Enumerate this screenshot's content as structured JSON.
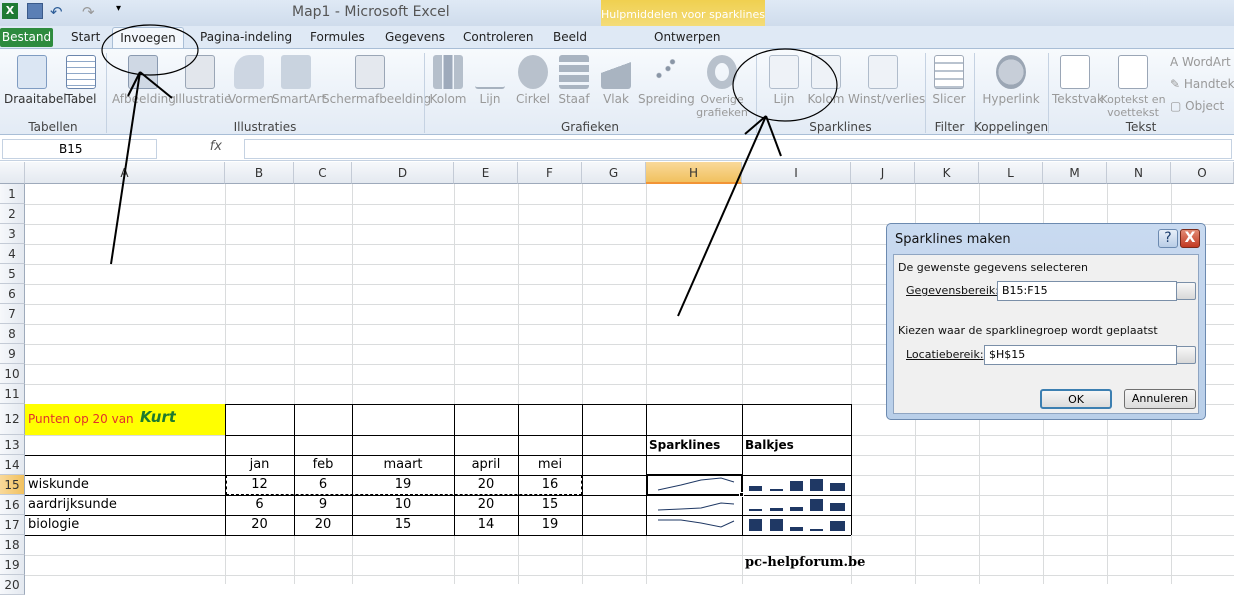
{
  "window": {
    "title": "Map1  -  Microsoft Excel",
    "context_group": "Hulpmiddelen voor sparklines"
  },
  "tabs": [
    "Bestand",
    "Start",
    "Invoegen",
    "Pagina-indeling",
    "Formules",
    "Gegevens",
    "Controleren",
    "Beeld",
    "Ontwerpen"
  ],
  "ribbon": {
    "buttons": [
      "Draaitabel",
      "Tabel",
      "Afbeelding",
      "Illustratie",
      "Vormen",
      "SmartArt",
      "Schermafbeelding",
      "Kolom",
      "Lijn",
      "Cirkel",
      "Staaf",
      "Vlak",
      "Spreiding",
      "Overige grafieken",
      "Lijn",
      "Kolom",
      "Winst/verlies",
      "Slicer",
      "Hyperlink",
      "Tekstvak",
      "Koptekst en voettekst",
      "WordArt",
      "Handtekening",
      "Object"
    ],
    "groups": [
      "Tabellen",
      "Illustraties",
      "Grafieken",
      "Sparklines",
      "Filter",
      "Koppelingen",
      "Tekst"
    ]
  },
  "formula_bar": {
    "name_box": "B15",
    "fx": "fx",
    "formula": ""
  },
  "columns": [
    "A",
    "B",
    "C",
    "D",
    "E",
    "F",
    "G",
    "H",
    "I",
    "J",
    "K",
    "L",
    "M",
    "N",
    "O"
  ],
  "rows": [
    "1",
    "2",
    "3",
    "4",
    "5",
    "6",
    "7",
    "8",
    "9",
    "10",
    "11",
    "12",
    "13",
    "14",
    "15",
    "16",
    "17",
    "18",
    "19",
    "20"
  ],
  "sheet": {
    "title_text": "Punten op 20 van",
    "title_name": "Kurt",
    "h_sparklines": "Sparklines",
    "h_balkjes": "Balkjes",
    "months": [
      "jan",
      "feb",
      "maart",
      "april",
      "mei"
    ],
    "subjects": [
      {
        "name": "wiskunde",
        "scores": [
          "12",
          "6",
          "19",
          "20",
          "16"
        ]
      },
      {
        "name": "aardrijksunde",
        "scores": [
          "6",
          "9",
          "10",
          "20",
          "15"
        ]
      },
      {
        "name": "biologie",
        "scores": [
          "20",
          "20",
          "15",
          "14",
          "19"
        ]
      }
    ],
    "watermark": "pc-helpforum.be"
  },
  "dialog": {
    "title": "Sparklines maken",
    "help": "?",
    "close": "X",
    "section1": "De gewenste gegevens selecteren",
    "data_label": "Gegevensbereik:",
    "data_value": "B15:F15",
    "section2": "Kiezen waar de sparklinegroep wordt geplaatst",
    "loc_label": "Locatiebereik:",
    "loc_value": "$H$15",
    "ok": "OK",
    "cancel": "Annuleren"
  },
  "colors": {
    "accent": "#2e8b3e",
    "title_fill": "#ffff00",
    "sparkline": "#1f3864"
  }
}
